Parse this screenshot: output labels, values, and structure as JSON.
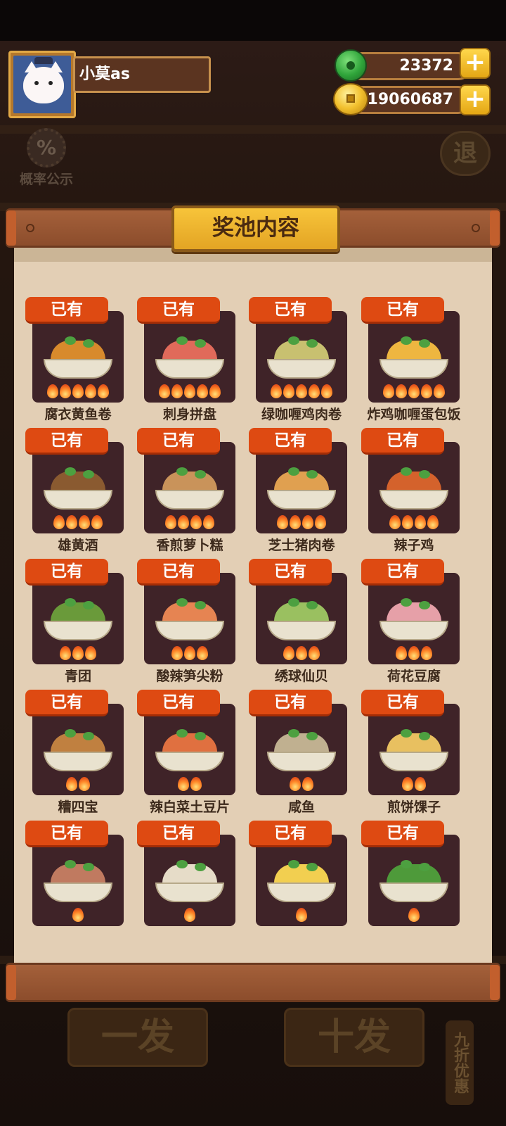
{
  "player": {
    "name": "小莫as"
  },
  "currency": {
    "jade": "23372",
    "coins": "19060687",
    "jade_icon": "jade-icon",
    "coin_icon": "coin-icon"
  },
  "background": {
    "probability_icon": "%",
    "probability_label": "概率公示",
    "exit_label": "退",
    "draw_one": "一发",
    "draw_ten": "十发",
    "discount": "九折优惠"
  },
  "modal": {
    "title": "奖池内容",
    "items": [
      {
        "tag": "已有",
        "name": "腐衣黄鱼卷",
        "flames": 5,
        "color": "#d88a2c"
      },
      {
        "tag": "已有",
        "name": "刺身拼盘",
        "flames": 5,
        "color": "#e06a5a"
      },
      {
        "tag": "已有",
        "name": "绿咖喱鸡肉卷",
        "flames": 5,
        "color": "#c8c070"
      },
      {
        "tag": "已有",
        "name": "炸鸡咖喱蛋包饭",
        "flames": 5,
        "color": "#eeb640"
      },
      {
        "tag": "已有",
        "name": "雄黄酒",
        "flames": 4,
        "color": "#8a5a30"
      },
      {
        "tag": "已有",
        "name": "香煎萝卜糕",
        "flames": 4,
        "color": "#c9935a"
      },
      {
        "tag": "已有",
        "name": "芝士猪肉卷",
        "flames": 4,
        "color": "#e0a050"
      },
      {
        "tag": "已有",
        "name": "辣子鸡",
        "flames": 4,
        "color": "#d4622c"
      },
      {
        "tag": "已有",
        "name": "青团",
        "flames": 3,
        "color": "#6a9a3a"
      },
      {
        "tag": "已有",
        "name": "酸辣笋尖粉",
        "flames": 3,
        "color": "#e68452"
      },
      {
        "tag": "已有",
        "name": "绣球仙贝",
        "flames": 3,
        "color": "#9ac060"
      },
      {
        "tag": "已有",
        "name": "荷花豆腐",
        "flames": 3,
        "color": "#e6a0a8"
      },
      {
        "tag": "已有",
        "name": "糟四宝",
        "flames": 2,
        "color": "#c08040"
      },
      {
        "tag": "已有",
        "name": "辣白菜土豆片",
        "flames": 2,
        "color": "#e07040"
      },
      {
        "tag": "已有",
        "name": "咸鱼",
        "flames": 2,
        "color": "#c0b090"
      },
      {
        "tag": "已有",
        "name": "煎饼馃子",
        "flames": 2,
        "color": "#e8c060"
      },
      {
        "tag": "已有",
        "name": "",
        "flames": 1,
        "color": "#c07a60"
      },
      {
        "tag": "已有",
        "name": "",
        "flames": 1,
        "color": "#e6dcc8"
      },
      {
        "tag": "已有",
        "name": "",
        "flames": 1,
        "color": "#f2cf50"
      },
      {
        "tag": "已有",
        "name": "",
        "flames": 1,
        "color": "#4e9a3a"
      }
    ]
  },
  "colors": {
    "tag_orange": "#de4a12",
    "card_bg": "#3f2328",
    "paper": "#e3cfb5",
    "wood": "#8c4d2c",
    "title_gold": "#f2b832"
  }
}
